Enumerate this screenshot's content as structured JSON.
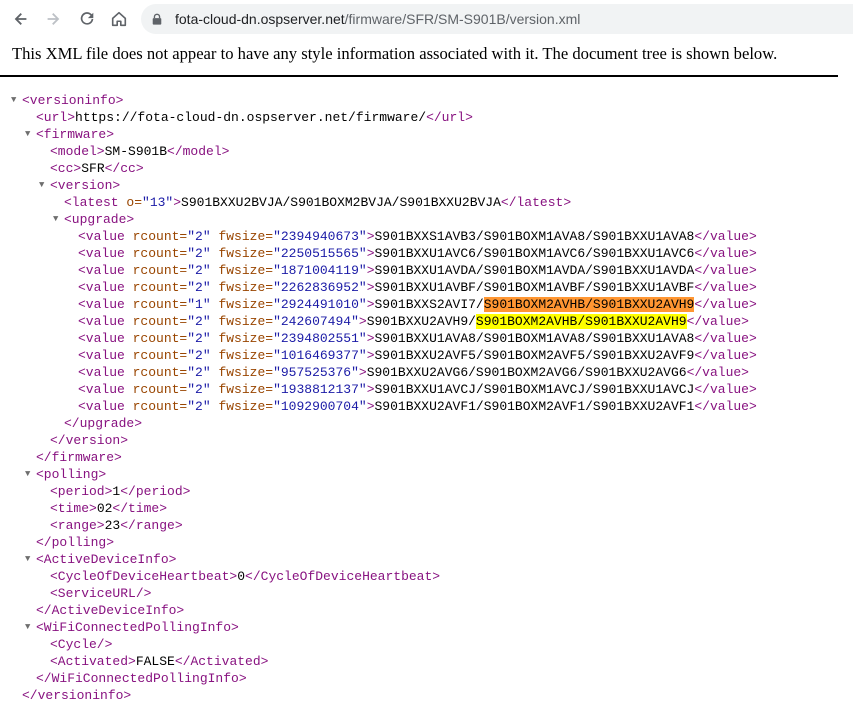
{
  "browser": {
    "url_host": "fota-cloud-dn.ospserver.net",
    "url_path": "/firmware/SFR/SM-S901B/version.xml"
  },
  "notice": "This XML file does not appear to have any style information associated with it. The document tree is shown below.",
  "xml": {
    "url": "https://fota-cloud-dn.ospserver.net/firmware/",
    "model": "SM-S901B",
    "cc": "SFR",
    "latest_o": "13",
    "latest": "S901BXXU2BVJA/S901BOXM2BVJA/S901BXXU2BVJA",
    "upgrade_values": [
      {
        "rcount": "2",
        "fwsize": "2394940673",
        "value": "S901BXXS1AVB3/S901BOXM1AVA8/S901BXXU1AVA8"
      },
      {
        "rcount": "2",
        "fwsize": "2250515565",
        "value": "S901BXXU1AVC6/S901BOXM1AVC6/S901BXXU1AVC6"
      },
      {
        "rcount": "2",
        "fwsize": "1871004119",
        "value": "S901BXXU1AVDA/S901BOXM1AVDA/S901BXXU1AVDA"
      },
      {
        "rcount": "2",
        "fwsize": "2262836952",
        "value": "S901BXXU1AVBF/S901BOXM1AVBF/S901BXXU1AVBF"
      },
      {
        "rcount": "1",
        "fwsize": "2924491010",
        "value_pre": "S901BXXS2AVI7/",
        "value_hl": "S901BOXM2AVHB/S901BXXU2AVH9",
        "hl": "orange"
      },
      {
        "rcount": "2",
        "fwsize": "242607494",
        "value_pre": "S901BXXU2AVH9/",
        "value_hl": "S901BOXM2AVHB/S901BXXU2AVH9",
        "hl": "yellow"
      },
      {
        "rcount": "2",
        "fwsize": "2394802551",
        "value": "S901BXXU1AVA8/S901BOXM1AVA8/S901BXXU1AVA8"
      },
      {
        "rcount": "2",
        "fwsize": "1016469377",
        "value": "S901BXXU2AVF5/S901BOXM2AVF5/S901BXXU2AVF9"
      },
      {
        "rcount": "2",
        "fwsize": "957525376",
        "value": "S901BXXU2AVG6/S901BOXM2AVG6/S901BXXU2AVG6"
      },
      {
        "rcount": "2",
        "fwsize": "1938812137",
        "value": "S901BXXU1AVCJ/S901BOXM1AVCJ/S901BXXU1AVCJ"
      },
      {
        "rcount": "2",
        "fwsize": "1092900704",
        "value": "S901BXXU2AVF1/S901BOXM2AVF1/S901BXXU2AVF1"
      }
    ],
    "polling": {
      "period": "1",
      "time": "02",
      "range": "23"
    },
    "cycle_of_device_heartbeat": "0",
    "activated": "FALSE"
  }
}
